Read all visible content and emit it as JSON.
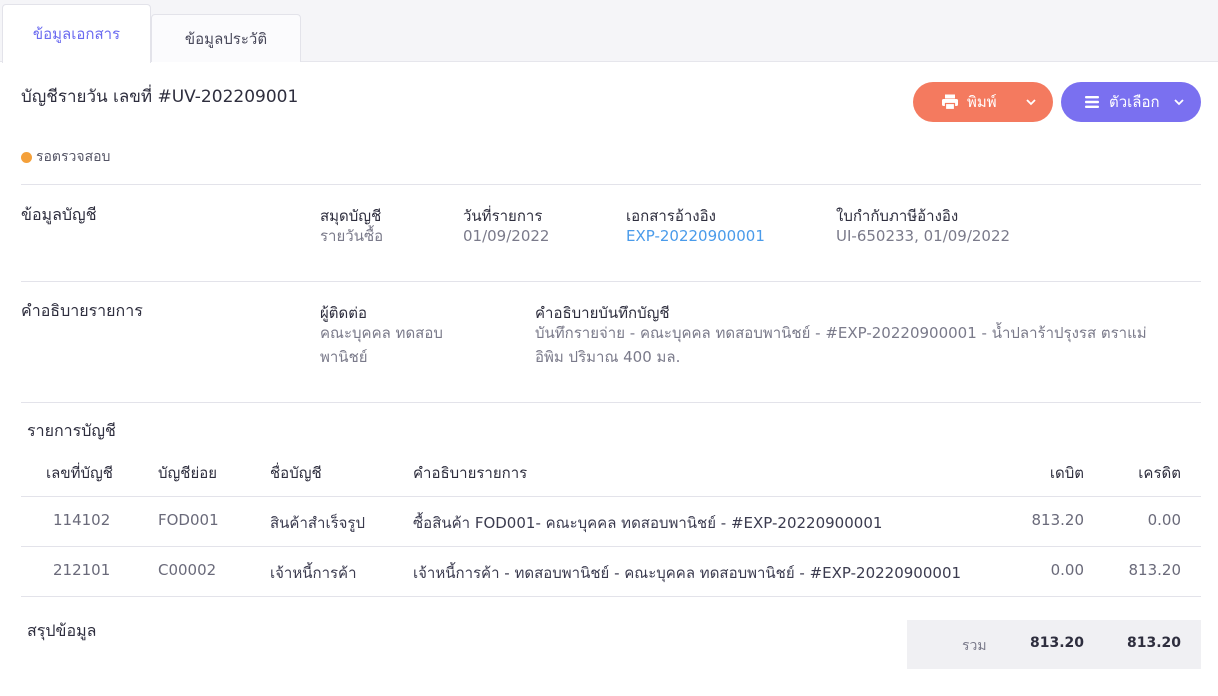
{
  "tabs": [
    {
      "label": "ข้อมูลเอกสาร",
      "active": true
    },
    {
      "label": "ข้อมูลประวัติ",
      "active": false
    }
  ],
  "header": {
    "title": "บัญชีรายวัน เลขที่ #UV-202209001",
    "print_label": "พิมพ์",
    "options_label": "ตัวเลือก"
  },
  "status": {
    "label": "รอตรวจสอบ",
    "color": "#f4a03a"
  },
  "account_info": {
    "section_title": "ข้อมูลบัญชี",
    "journal_label": "สมุดบัญชี",
    "journal_value": "รายวันซื้อ",
    "date_label": "วันที่รายการ",
    "date_value": "01/09/2022",
    "ref_doc_label": "เอกสารอ้างอิง",
    "ref_doc_value": "EXP-20220900001",
    "tax_invoice_label": "ใบกำกับภาษีอ้างอิง",
    "tax_invoice_value": "UI-650233, 01/09/2022"
  },
  "description": {
    "section_title": "คำอธิบายรายการ",
    "contact_label": "ผู้ติดต่อ",
    "contact_line1": "คณะบุคคล ทดสอบ",
    "contact_line2": "พานิชย์",
    "note_label": "คำอธิบายบันทึกบัญชี",
    "note_line1": "บันทึกรายจ่าย - คณะบุคคล ทดสอบพานิชย์ - #EXP-20220900001 - น้ำปลาร้าปรุงรส ตราแม่",
    "note_line2": "อิพิม ปริมาณ 400 มล."
  },
  "entries": {
    "section_title": "รายการบัญชี",
    "columns": {
      "account_no": "เลขที่บัญชี",
      "sub_account": "บัญชีย่อย",
      "account_name": "ชื่อบัญชี",
      "description": "คำอธิบายรายการ",
      "debit": "เดบิต",
      "credit": "เครดิต"
    },
    "rows": [
      {
        "account_no": "114102",
        "sub_account": "FOD001",
        "account_name": "สินค้าสำเร็จรูป",
        "description": "ซื้อสินค้า FOD001- คณะบุคคล ทดสอบพานิชย์ - #EXP-20220900001",
        "debit": "813.20",
        "credit": "0.00"
      },
      {
        "account_no": "212101",
        "sub_account": "C00002",
        "account_name": "เจ้าหนี้การค้า",
        "description": "เจ้าหนี้การค้า - ทดสอบพานิชย์ - คณะบุคคล ทดสอบพานิชย์ - #EXP-20220900001",
        "debit": "0.00",
        "credit": "813.20"
      }
    ]
  },
  "summary": {
    "section_title": "สรุปข้อมูล",
    "total_label": "รวม",
    "total_debit": "813.20",
    "total_credit": "813.20"
  },
  "colors": {
    "accent": "#6b6bf0",
    "print_button": "#f47a5f",
    "options_button": "#7a70f0",
    "link": "#4a9bea"
  }
}
